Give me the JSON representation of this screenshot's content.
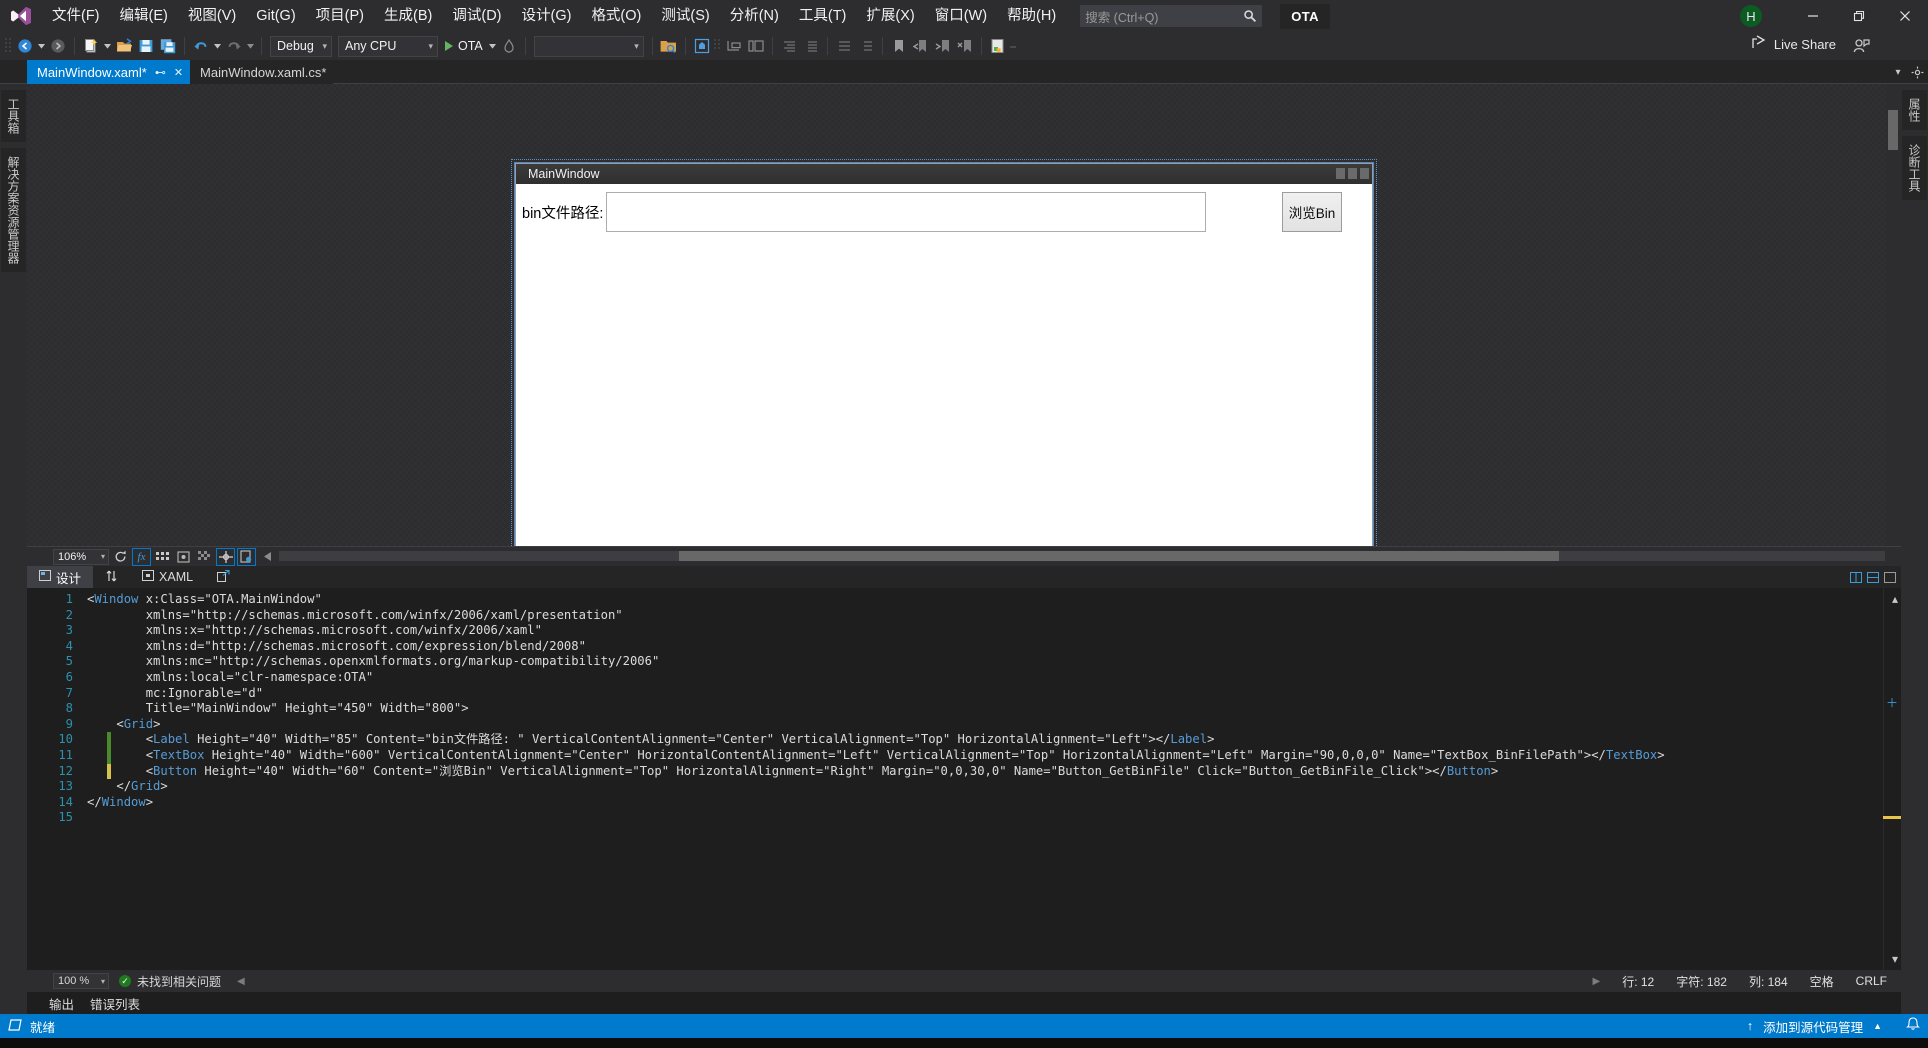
{
  "app": {
    "project_badge": "OTA",
    "avatar_initial": "H",
    "live_share": "Live Share"
  },
  "menu": {
    "items": [
      {
        "label": "文件(F)",
        "name": "menu-file"
      },
      {
        "label": "编辑(E)",
        "name": "menu-edit"
      },
      {
        "label": "视图(V)",
        "name": "menu-view"
      },
      {
        "label": "Git(G)",
        "name": "menu-git"
      },
      {
        "label": "项目(P)",
        "name": "menu-project"
      },
      {
        "label": "生成(B)",
        "name": "menu-build"
      },
      {
        "label": "调试(D)",
        "name": "menu-debug"
      },
      {
        "label": "设计(G)",
        "name": "menu-design"
      },
      {
        "label": "格式(O)",
        "name": "menu-format"
      },
      {
        "label": "测试(S)",
        "name": "menu-test"
      },
      {
        "label": "分析(N)",
        "name": "menu-analyze"
      },
      {
        "label": "工具(T)",
        "name": "menu-tools"
      },
      {
        "label": "扩展(X)",
        "name": "menu-extensions"
      },
      {
        "label": "窗口(W)",
        "name": "menu-window"
      },
      {
        "label": "帮助(H)",
        "name": "menu-help"
      }
    ]
  },
  "search": {
    "placeholder": "搜索 (Ctrl+Q)",
    "icon": "search-icon"
  },
  "toolbar": {
    "configuration": "Debug",
    "platform": "Any CPU",
    "start_label": "OTA",
    "empty_combo": ""
  },
  "tabs": {
    "items": [
      {
        "label": "MainWindow.xaml*",
        "active": true,
        "name": "tab-mainwindow-xaml"
      },
      {
        "label": "MainWindow.xaml.cs*",
        "active": false,
        "name": "tab-mainwindow-xaml-cs"
      }
    ]
  },
  "rails": {
    "left": [
      "工具箱",
      "解决方案资源管理器"
    ],
    "right": [
      "属性",
      "诊断工具"
    ]
  },
  "designer": {
    "window_title": "MainWindow",
    "label_text": "bin文件路径:",
    "textbox_value": "",
    "button_text": "浏览Bin",
    "zoom": "106%"
  },
  "split_tabs": {
    "design_label": "设计",
    "xaml_label": "XAML",
    "swap_icon": "swap-arrows-icon",
    "popout_icon": "popout-icon"
  },
  "code": {
    "language": "XAML",
    "lines": [
      {
        "n": "1",
        "text": "<Window x:Class=\"OTA.MainWindow\""
      },
      {
        "n": "2",
        "text": "        xmlns=\"http://schemas.microsoft.com/winfx/2006/xaml/presentation\""
      },
      {
        "n": "3",
        "text": "        xmlns:x=\"http://schemas.microsoft.com/winfx/2006/xaml\""
      },
      {
        "n": "4",
        "text": "        xmlns:d=\"http://schemas.microsoft.com/expression/blend/2008\""
      },
      {
        "n": "5",
        "text": "        xmlns:mc=\"http://schemas.openxmlformats.org/markup-compatibility/2006\""
      },
      {
        "n": "6",
        "text": "        xmlns:local=\"clr-namespace:OTA\""
      },
      {
        "n": "7",
        "text": "        mc:Ignorable=\"d\""
      },
      {
        "n": "8",
        "text": "        Title=\"MainWindow\" Height=\"450\" Width=\"800\">"
      },
      {
        "n": "9",
        "text": "    <Grid>"
      },
      {
        "n": "10",
        "text": "        <Label Height=\"40\" Width=\"85\" Content=\"bin文件路径: \" VerticalContentAlignment=\"Center\" VerticalAlignment=\"Top\" HorizontalAlignment=\"Left\"></Label>"
      },
      {
        "n": "11",
        "text": "        <TextBox Height=\"40\" Width=\"600\" VerticalContentAlignment=\"Center\" HorizontalContentAlignment=\"Left\" VerticalAlignment=\"Top\" HorizontalAlignment=\"Left\" Margin=\"90,0,0,0\" Name=\"TextBox_BinFilePath\"></TextBox>"
      },
      {
        "n": "12",
        "text": "        <Button Height=\"40\" Width=\"60\" Content=\"浏览Bin\" VerticalAlignment=\"Top\" HorizontalAlignment=\"Right\" Margin=\"0,0,30,0\" Name=\"Button_GetBinFile\" Click=\"Button_GetBinFile_Click\"></Button>"
      },
      {
        "n": "13",
        "text": "    </Grid>"
      },
      {
        "n": "14",
        "text": "</Window>"
      },
      {
        "n": "15",
        "text": ""
      }
    ]
  },
  "editor_status": {
    "zoom": "100 %",
    "issues": "未找到相关问题",
    "line": "行: 12",
    "char": "字符: 182",
    "col": "列: 184",
    "spaces": "空格",
    "eol": "CRLF"
  },
  "bottom_tabs": {
    "items": [
      "输出",
      "错误列表"
    ]
  },
  "statusbar": {
    "ready": "就绪",
    "source_control": "添加到源代码管理",
    "bell_icon": "bell-icon",
    "up-arrow": "up-arrow-icon"
  },
  "colors": {
    "accent": "#007acc",
    "chrome": "#2d2d30",
    "editor_bg": "#1e1e1e",
    "tab_active": "#007acc",
    "string": "#4ec9b0",
    "tag": "#569cd6",
    "attr": "#9cdcfe"
  }
}
